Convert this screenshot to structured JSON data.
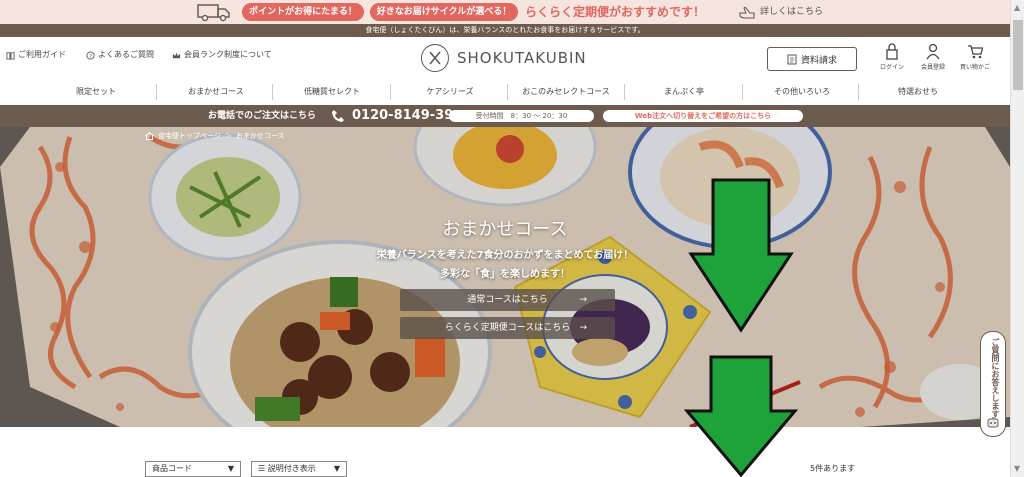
{
  "promo": {
    "pill1": "ポイントがお得にたまる！",
    "pill2": "好きなお届けサイクルが選べる！",
    "main": "らくらく定期便がおすすめです！",
    "detail": "詳しくはこちら"
  },
  "tagline": "食宅便（しょくたくびん）は、栄養バランスのとれたお食事をお届けするサービスです。",
  "header": {
    "links": [
      "ご利用ガイド",
      "よくあるご質問",
      "会員ランク制度について"
    ],
    "logo": "SHOKUTAKUBIN",
    "doc_request": "資料請求",
    "icons": [
      "ログイン",
      "会員登録",
      "買い物かご"
    ]
  },
  "nav": [
    "限定セット",
    "おまかせコース",
    "低糖質セレクト",
    "ケアシリーズ",
    "おこのみセレクトコース",
    "まんぷく亭",
    "その他いろいろ",
    "特選おせち"
  ],
  "phonebar": {
    "text": "お電話でのご注文はこちら",
    "number": "0120-8149-39",
    "hours": "受付時間　8：30 ～ 20：30",
    "web": "Web注文へ切り替えをご希望の方はこちら"
  },
  "breadcrumb": [
    "食宅便トップページ",
    "＞",
    "おまかせコース"
  ],
  "hero": {
    "title": "おまかせコース",
    "sub1": "栄養バランスを考えた7食分のおかずをまとめてお届け！",
    "sub2": "多彩な「食」を楽しめます！",
    "btn1": "通常コースはこちら",
    "btn2": "らくらく定期便コースはこちら",
    "arrow": "→"
  },
  "side_tab": "ご質問にお答えします",
  "controls": {
    "sort": "商品コード",
    "view": "説明付き表示",
    "count": "5件あります"
  },
  "colors": {
    "brand_brown": "#6d5b4f",
    "accent_red": "#e2675f",
    "promo_bg": "#f6e4de",
    "arrow_green": "#1ea33a"
  }
}
